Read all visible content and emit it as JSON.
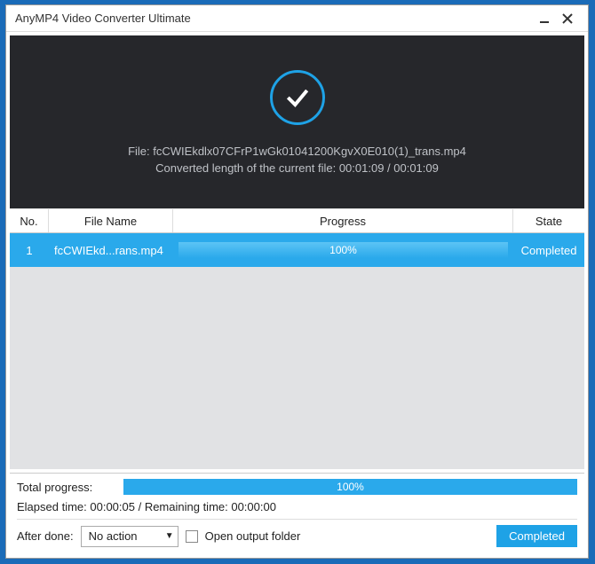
{
  "window": {
    "title": "AnyMP4 Video Converter Ultimate"
  },
  "hero": {
    "file_label": "File: fcCWIEkdlx07CFrP1wGk01041200KgvX0E010(1)_trans.mp4",
    "converted_label": "Converted length of the current file: 00:01:09 / 00:01:09"
  },
  "columns": {
    "no": "No.",
    "file_name": "File Name",
    "progress": "Progress",
    "state": "State"
  },
  "rows": [
    {
      "no": "1",
      "file_name": "fcCWIEkd...rans.mp4",
      "progress_text": "100%",
      "progress_pct": 100,
      "state": "Completed"
    }
  ],
  "footer": {
    "total_label": "Total progress:",
    "total_text": "100%",
    "total_pct": 100,
    "times": "Elapsed time: 00:00:05 / Remaining time: 00:00:00",
    "after_done_label": "After done:",
    "after_done_value": "No action",
    "open_folder_label": "Open output folder",
    "completed_button": "Completed"
  }
}
